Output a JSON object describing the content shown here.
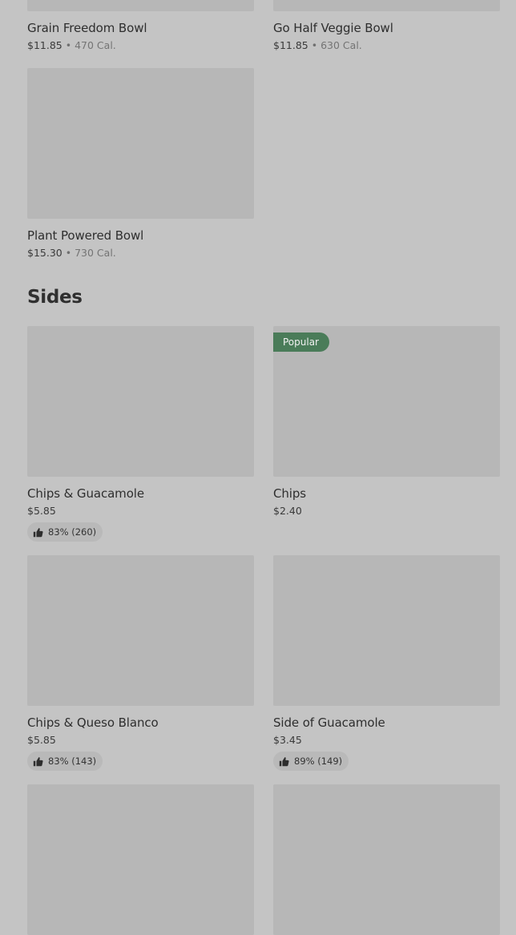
{
  "top_items": [
    {
      "name": "Grain Freedom Bowl",
      "price": "$11.85",
      "sep": "•",
      "calories": "470 Cal."
    },
    {
      "name": "Go Half Veggie Bowl",
      "price": "$11.85",
      "sep": "•",
      "calories": "630 Cal."
    },
    {
      "name": "Plant Powered Bowl",
      "price": "$15.30",
      "sep": "•",
      "calories": "730 Cal."
    }
  ],
  "sides": {
    "title": "Sides",
    "items": [
      {
        "name": "Chips & Guacamole",
        "price": "$5.85",
        "rating": "83% (260)"
      },
      {
        "name": "Chips",
        "price": "$2.40",
        "badge": "Popular"
      },
      {
        "name": "Chips & Queso Blanco",
        "price": "$5.85",
        "rating": "83% (143)"
      },
      {
        "name": "Side of Guacamole",
        "price": "$3.45",
        "rating": "89% (149)"
      }
    ]
  },
  "icons": {
    "rating": "thumbs-up-icon"
  },
  "colors": {
    "background": "#c4c4c4",
    "image_placeholder": "#b7b7b7",
    "badge": "#4a7c59"
  }
}
